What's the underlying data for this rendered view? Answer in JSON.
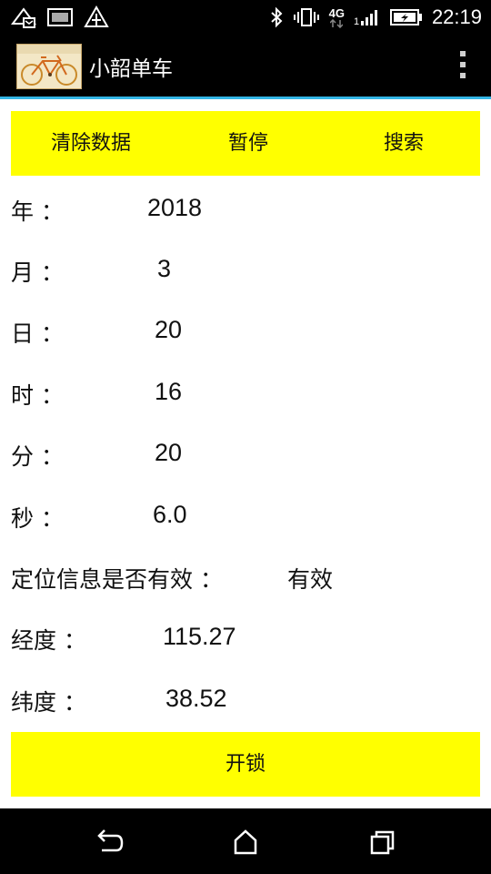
{
  "status_bar": {
    "time": "22:19",
    "network": "4G",
    "left_icons": [
      "wifi-calling-icon",
      "image-icon",
      "alert-icon"
    ],
    "right_icons": [
      "bluetooth-icon",
      "vibrate-icon",
      "signal-icon",
      "battery-charging-icon"
    ]
  },
  "app_bar": {
    "title": "小韶单车",
    "logo": "bicycle-logo",
    "overflow_icon": "overflow-menu-icon"
  },
  "toolbar": {
    "clear_label": "清除数据",
    "pause_label": "暂停",
    "search_label": "搜索"
  },
  "fields": [
    {
      "label": "年 ：",
      "value": "2018"
    },
    {
      "label": "月 ：",
      "value": "3"
    },
    {
      "label": "日 ：",
      "value": "20"
    },
    {
      "label": "时 ：",
      "value": "16"
    },
    {
      "label": "分 ：",
      "value": "20"
    },
    {
      "label": "秒 ：",
      "value": "6.0"
    },
    {
      "label": "定位信息是否有效 ：",
      "value": "有效"
    },
    {
      "label": "经度 ：",
      "value": "115.27"
    },
    {
      "label": "纬度 ：",
      "value": "38.52"
    }
  ],
  "unlock_label": "开锁",
  "nav": {
    "back_icon": "back-icon",
    "home_icon": "home-icon",
    "recents_icon": "recents-icon"
  },
  "colors": {
    "accent": "#33b5e5",
    "button_yellow": "#ffff00",
    "bar_black": "#000000"
  }
}
